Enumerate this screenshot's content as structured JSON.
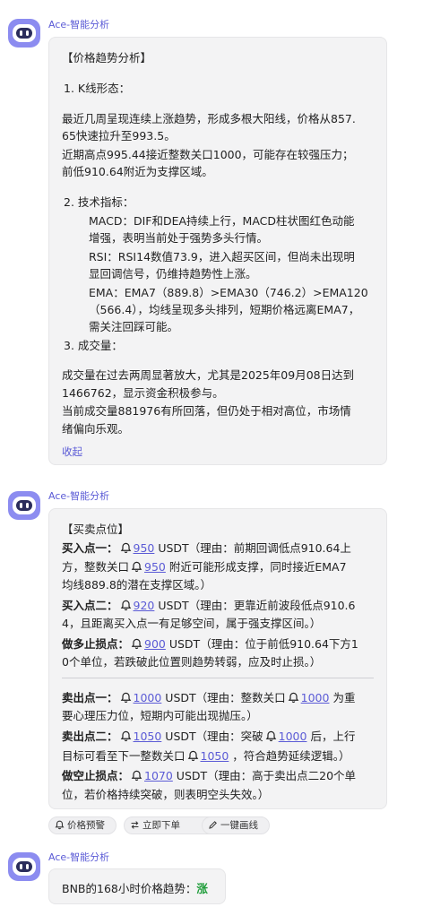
{
  "sender_name": "Ace-智能分析",
  "msg1": {
    "heading": "【价格趋势分析】",
    "s1_title": "1. K线形态：",
    "s1_p1_l1": "最近几周呈现连续上涨趋势，形成多根大阳线，价格从857.",
    "s1_p1_l2": "65快速拉升至993.5。",
    "s1_p2_l1": "近期高点995.44接近整数关口1000，可能存在较强压力；",
    "s1_p2_l2": "前低910.64附近为支撑区域。",
    "s2_title": "2. 技术指标：",
    "macd_l1": "MACD：DIF和DEA持续上行，MACD柱状图红色动能",
    "macd_l2": "增强，表明当前处于强势多头行情。",
    "rsi_l1": "RSI：RSI14数值73.9，进入超买区间，但尚未出现明",
    "rsi_l2": "显回调信号，仍维持趋势性上涨。",
    "ema_l1": "EMA：EMA7（889.8）>EMA30（746.2）>EMA120",
    "ema_l2": "（566.4），均线呈现多头排列，短期价格远离EMA7，",
    "ema_l3": "需关注回踩可能。",
    "s3_title": "3. 成交量：",
    "s3_p1_l1": "成交量在过去两周显著放大，尤其是2025年09月08日达到",
    "s3_p1_l2": "1466762，显示资金积极参与。",
    "s3_p2_l1": "当前成交量881976有所回落，但仍处于相对高位，市场情",
    "s3_p2_l2": "绪偏向乐观。",
    "collapse": "收起"
  },
  "msg2": {
    "heading": "【买卖点位】",
    "buy1_label": "买入点一：",
    "buy1_price": "950",
    "buy1_a": " USDT（理由：前期回调低点910.64上",
    "buy1_l2a": "方，整数关口",
    "buy1_l2price": "950",
    "buy1_l2b": " 附近可能形成支撑，同时接近EMA7",
    "buy1_l3": "均线889.8的潜在支撑区域。）",
    "buy2_label": "买入点二：",
    "buy2_price": "920",
    "buy2_a": " USDT（理由：更靠近前波段低点910.6",
    "buy2_l2": "4，且距离买入点一有足够空间，属于强支撑区间。）",
    "sl_long_label": "做多止损点：",
    "sl_long_price": "900",
    "sl_long_a": " USDT（理由：位于前低910.64下方1",
    "sl_long_l2": "0个单位，若跌破此位置则趋势转弱，应及时止损。）",
    "sell1_label": "卖出点一：",
    "sell1_price": "1000",
    "sell1_a": " USDT（理由：整数关口",
    "sell1_price2": "1000",
    "sell1_b": " 为重",
    "sell1_l2": "要心理压力位，短期内可能出现抛压。）",
    "sell2_label": "卖出点二：",
    "sell2_price": "1050",
    "sell2_a": " USDT（理由：突破",
    "sell2_price2": "1000",
    "sell2_b": " 后，上行",
    "sell2_l2a": "目标可看至下一整数关口",
    "sell2_l2price": "1050",
    "sell2_l2b": " ，符合趋势延续逻辑。）",
    "sl_short_label": "做空止损点：",
    "sl_short_price": "1070",
    "sl_short_a": " USDT（理由：高于卖出点二20个单",
    "sl_short_l2": "位，若价格持续突破，则表明空头失效。）"
  },
  "actions": {
    "alert": "价格预警",
    "order": "立即下单",
    "draw": "一键画线"
  },
  "msg3": {
    "text": "BNB的168小时价格趋势：",
    "trend": "涨"
  },
  "colors": {
    "accent": "#5b5bd6",
    "bubble": "#f3f3f4",
    "up": "#1f9d3a"
  }
}
